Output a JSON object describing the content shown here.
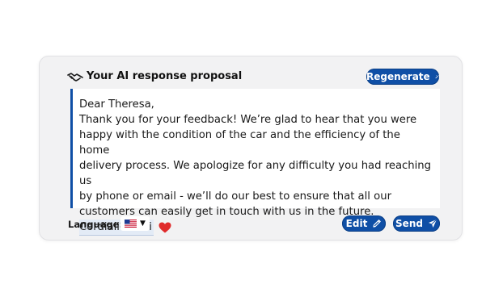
{
  "header": {
    "title": "Your AI response proposal",
    "icon": "handshake-icon",
    "regenerate_label": "Regenerate"
  },
  "message": {
    "greeting": "Dear Theresa,",
    "lines": [
      "Thank you for your feedback! We’re glad to hear that you were",
      "happy with the condition of the car and the efficiency of the home",
      "delivery process. We apologize for any difficulty you had reaching us",
      "by phone or email - we’ll do our best to ensure that all our",
      "customers can easily get in touch with us in the future."
    ],
    "signature": "Cordiali saluti",
    "signature_emoji": "heart-icon"
  },
  "footer": {
    "language_label": "Language:",
    "language_selected": "us-flag-icon",
    "edit_label": "Edit",
    "send_label": "Send"
  },
  "colors": {
    "accent": "#0f4fa6",
    "card_bg": "#f2f2f3",
    "heart": "#e02b2b"
  }
}
